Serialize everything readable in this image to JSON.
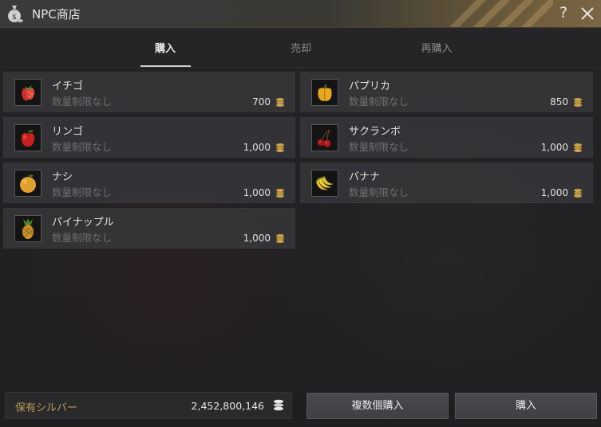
{
  "window": {
    "title": "NPC商店",
    "help_label": "?"
  },
  "tabs": [
    {
      "label": "購入",
      "active": true
    },
    {
      "label": "売却",
      "active": false
    },
    {
      "label": "再購入",
      "active": false
    }
  ],
  "items": [
    {
      "name": "イチゴ",
      "limit": "数量制限なし",
      "price": "700",
      "icon": "strawberry-icon"
    },
    {
      "name": "パプリカ",
      "limit": "数量制限なし",
      "price": "850",
      "icon": "paprika-icon"
    },
    {
      "name": "リンゴ",
      "limit": "数量制限なし",
      "price": "1,000",
      "icon": "apple-icon"
    },
    {
      "name": "サクランボ",
      "limit": "数量制限なし",
      "price": "1,000",
      "icon": "cherry-icon"
    },
    {
      "name": "ナシ",
      "limit": "数量制限なし",
      "price": "1,000",
      "icon": "pear-icon"
    },
    {
      "name": "バナナ",
      "limit": "数量制限なし",
      "price": "1,000",
      "icon": "banana-icon"
    },
    {
      "name": "パイナップル",
      "limit": "数量制限なし",
      "price": "1,000",
      "icon": "pineapple-icon"
    }
  ],
  "footer": {
    "silver_label": "保有シルバー",
    "silver_value": "2,452,800,146",
    "bulk_buy_label": "複数個購入",
    "buy_label": "購入"
  },
  "colors": {
    "silver_label": "#b89a56",
    "coin": "#c9a24a",
    "active_tab": "#e8e8e8",
    "inactive_tab": "#8a8a8a"
  }
}
